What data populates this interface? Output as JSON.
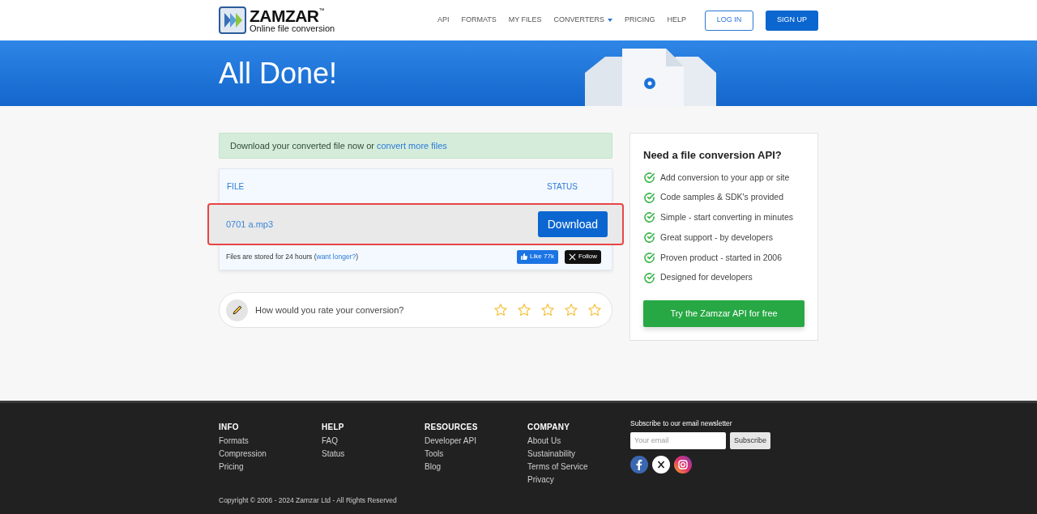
{
  "header": {
    "logo": {
      "name": "ZAMZAR",
      "trademark": "™",
      "tagline": "Online file conversion"
    },
    "nav": [
      {
        "label": "API",
        "dropdown": false
      },
      {
        "label": "FORMATS",
        "dropdown": false
      },
      {
        "label": "MY FILES",
        "dropdown": false
      },
      {
        "label": "CONVERTERS",
        "dropdown": true
      },
      {
        "label": "PRICING",
        "dropdown": false
      },
      {
        "label": "HELP",
        "dropdown": false
      }
    ],
    "login": "LOG IN",
    "signup": "SIGN UP"
  },
  "banner": {
    "title": "All Done!"
  },
  "notice": {
    "text": "Download your converted file now or ",
    "link": "convert more files"
  },
  "files_table": {
    "columns": [
      "FILE",
      "STATUS"
    ],
    "rows": [
      {
        "file": "0701 a.mp3",
        "action": "Download",
        "highlighted": true
      }
    ],
    "footer_text": "Files are stored for 24 hours (",
    "footer_link": "want longer?",
    "footer_end": ")",
    "like": "Like 77k",
    "follow": "Follow"
  },
  "rating": {
    "question": "How would you rate your conversion?",
    "stars": 0
  },
  "api_card": {
    "title": "Need a file conversion API?",
    "features": [
      "Add conversion to your app or site",
      "Code samples & SDK's provided",
      "Simple - start converting in minutes",
      "Great support - by developers",
      "Proven product - started in 2006",
      "Designed for developers"
    ],
    "button": "Try the Zamzar API for free"
  },
  "footer": {
    "columns": [
      {
        "heading": "INFO",
        "links": [
          "Formats",
          "Compression",
          "Pricing"
        ]
      },
      {
        "heading": "HELP",
        "links": [
          "FAQ",
          "Status"
        ]
      },
      {
        "heading": "RESOURCES",
        "links": [
          "Developer API",
          "Tools",
          "Blog"
        ]
      },
      {
        "heading": "COMPANY",
        "links": [
          "About Us",
          "Sustainability",
          "Terms of Service",
          "Privacy"
        ]
      }
    ],
    "newsletter": {
      "label": "Subscribe to our email newsletter",
      "placeholder": "Your email",
      "button": "Subscribe"
    },
    "copyright": "Copyright © 2006 - 2024 Zamzar Ltd - All Rights Reserved"
  }
}
